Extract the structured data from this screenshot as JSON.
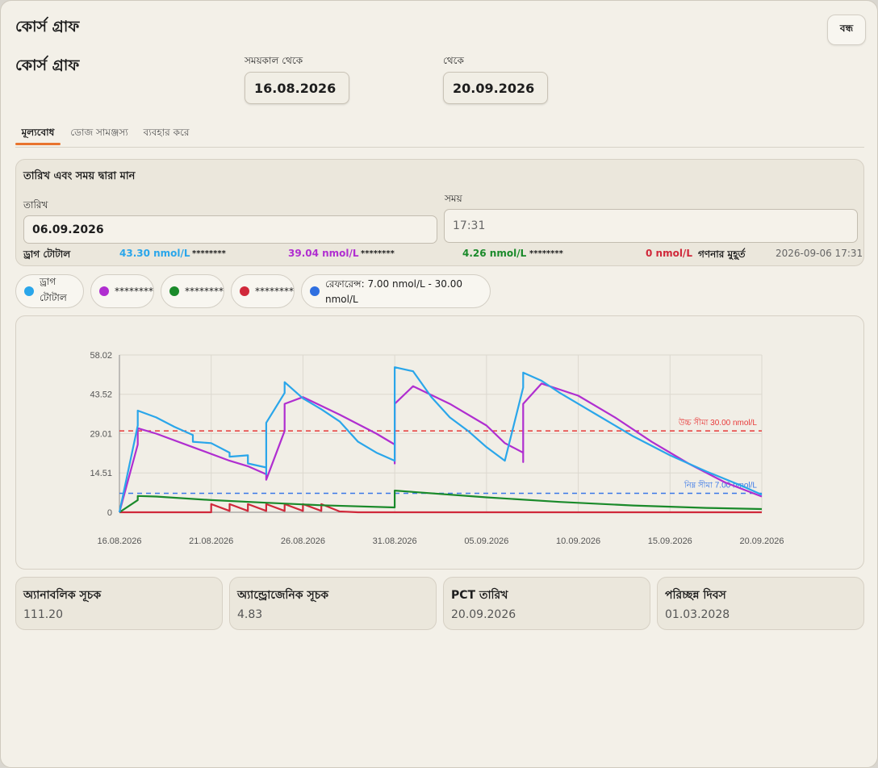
{
  "window": {
    "title": "কোর্স গ্রাফ",
    "close_label": "বন্ধ"
  },
  "header": {
    "title": "কোর্স গ্রাফ",
    "from_label": "সময়কাল থেকে",
    "from_value": "16.08.2026",
    "to_label": "থেকে",
    "to_value": "20.09.2026"
  },
  "tabs": [
    "মূল্যবোধ",
    "ডোজ সামঞ্জস্য",
    "ব্যবহার করে"
  ],
  "values_panel": {
    "title": "তারিখ এবং সময় দ্বারা মান",
    "date_label": "তারিখ",
    "date_value": "06.09.2026",
    "time_label": "সময়",
    "time_value": "17:31",
    "readings": {
      "total_label": "ড্রাগ টোটাল",
      "total_value": "43.30 nmol/L",
      "s1_mask": "********",
      "s1_value": "39.04 nmol/L",
      "s2_mask": "********",
      "s2_value": "4.26 nmol/L",
      "s3_mask": "********",
      "s3_value": "0 nmol/L",
      "calc_label": "গণনার মুহূর্ত",
      "calc_value": "2026-09-06 17:31"
    }
  },
  "legend": [
    {
      "label": "ড্রাগ টোটাল",
      "color": "#2aa6ea"
    },
    {
      "label": "********",
      "color": "#b02ed0"
    },
    {
      "label": "********",
      "color": "#1a8a2a"
    },
    {
      "label": "********",
      "color": "#d0283a"
    },
    {
      "label": "রেফারেন্স: 7.00 nmol/L - 30.00 nmol/L",
      "color": "#2f6fe0"
    }
  ],
  "chart_data": {
    "type": "line",
    "x_ticks": [
      "16.08.2026",
      "21.08.2026",
      "26.08.2026",
      "31.08.2026",
      "05.09.2026",
      "10.09.2026",
      "15.09.2026",
      "20.09.2026"
    ],
    "y_ticks": [
      "0",
      "14.51",
      "29.01",
      "43.52",
      "58.02"
    ],
    "ylim": [
      0,
      58.02
    ],
    "xlim": [
      "16.08.2026",
      "20.09.2026"
    ],
    "grid": true,
    "reference_lines": [
      {
        "label": "উচ্চ সীমা 30.00 nmol/L",
        "value": 30.0,
        "color": "#e83a3a"
      },
      {
        "label": "নিম্ন সীমা 7.00 nmol/L",
        "value": 7.0,
        "color": "#3a78e8"
      }
    ],
    "series": [
      {
        "color": "#2aa6ea",
        "x": [
          "16.08.2026",
          "17.08.2026",
          "17.08.2026",
          "18.08.2026",
          "19.08.2026",
          "20.08.2026",
          "20.08.2026",
          "21.08.2026",
          "22.08.2026",
          "22.08.2026",
          "23.08.2026",
          "23.08.2026",
          "24.08.2026",
          "24.08.2026",
          "24.08.2026",
          "25.08.2026",
          "25.08.2026",
          "25.08.2026",
          "26.08.2026",
          "27.08.2026",
          "28.08.2026",
          "29.08.2026",
          "30.08.2026",
          "31.08.2026",
          "31.08.2026",
          "31.08.2026",
          "01.09.2026",
          "02.09.2026",
          "03.09.2026",
          "04.09.2026",
          "05.09.2026",
          "06.09.2026",
          "07.09.2026",
          "07.09.2026",
          "08.09.2026",
          "09.09.2026",
          "11.09.2026",
          "13.09.2026",
          "15.09.2026",
          "17.09.2026",
          "19.09.2026",
          "20.09.2026"
        ],
        "y": [
          0,
          32,
          37.5,
          35,
          31.5,
          28.5,
          26,
          25.5,
          22,
          20.5,
          21,
          18,
          16.5,
          14,
          33,
          44,
          46.5,
          48,
          42,
          38,
          33.5,
          26,
          22,
          19,
          45,
          53.5,
          52,
          42.5,
          35,
          30,
          24,
          19,
          46,
          51.5,
          48.5,
          44,
          36,
          28,
          21,
          15,
          9.5,
          6.5
        ]
      },
      {
        "color": "#b02ed0",
        "x": [
          "16.08.2026",
          "17.08.2026",
          "17.08.2026",
          "18.08.2026",
          "20.08.2026",
          "22.08.2026",
          "23.08.2026",
          "24.08.2026",
          "24.08.2026",
          "25.08.2026",
          "25.08.2026",
          "26.08.2026",
          "28.08.2026",
          "30.08.2026",
          "31.08.2026",
          "31.08.2026",
          "31.08.2026",
          "01.09.2026",
          "03.09.2026",
          "05.09.2026",
          "06.09.2026",
          "07.09.2026",
          "07.09.2026",
          "07.09.2026",
          "08.09.2026",
          "10.09.2026",
          "12.09.2026",
          "14.09.2026",
          "16.09.2026",
          "18.09.2026",
          "20.09.2026"
        ],
        "y": [
          0,
          25,
          31,
          29,
          24,
          19,
          17,
          14,
          12,
          30,
          40,
          42.5,
          36,
          29,
          25,
          18,
          40,
          46.5,
          40,
          32,
          25.5,
          22,
          18.5,
          40,
          47.5,
          43,
          35,
          26,
          18,
          11,
          5.8
        ]
      },
      {
        "color": "#1a8a2a",
        "x": [
          "16.08.2026",
          "17.08.2026",
          "17.08.2026",
          "18.08.2026",
          "21.08.2026",
          "24.08.2026",
          "27.08.2026",
          "31.08.2026",
          "31.08.2026",
          "01.09.2026",
          "05.09.2026",
          "09.09.2026",
          "13.09.2026",
          "17.09.2026",
          "20.09.2026"
        ],
        "y": [
          0,
          4.5,
          6,
          5.8,
          4.5,
          3.5,
          2.6,
          1.8,
          8,
          7.5,
          5.5,
          3.8,
          2.5,
          1.6,
          1.2
        ]
      },
      {
        "color": "#d0283a",
        "x": [
          "16.08.2026",
          "21.08.2026",
          "21.08.2026",
          "22.08.2026",
          "22.08.2026",
          "23.08.2026",
          "23.08.2026",
          "24.08.2026",
          "24.08.2026",
          "25.08.2026",
          "25.08.2026",
          "26.08.2026",
          "26.08.2026",
          "27.08.2026",
          "27.08.2026",
          "28.08.2026",
          "29.08.2026",
          "20.09.2026"
        ],
        "y": [
          0,
          0,
          3,
          0.5,
          3,
          0.5,
          3,
          0.5,
          3,
          0.5,
          3,
          0.5,
          3,
          0.5,
          3,
          0.3,
          0,
          0
        ]
      }
    ]
  },
  "stats": [
    {
      "label": "অ্যানাবলিক সূচক",
      "value": "111.20"
    },
    {
      "label": "অ্যান্ড্রোজেনিক সূচক",
      "value": "4.83"
    },
    {
      "label": "PCT তারিখ",
      "value": "20.09.2026"
    },
    {
      "label": "পরিচ্ছন্ন দিবস",
      "value": "01.03.2028"
    }
  ]
}
